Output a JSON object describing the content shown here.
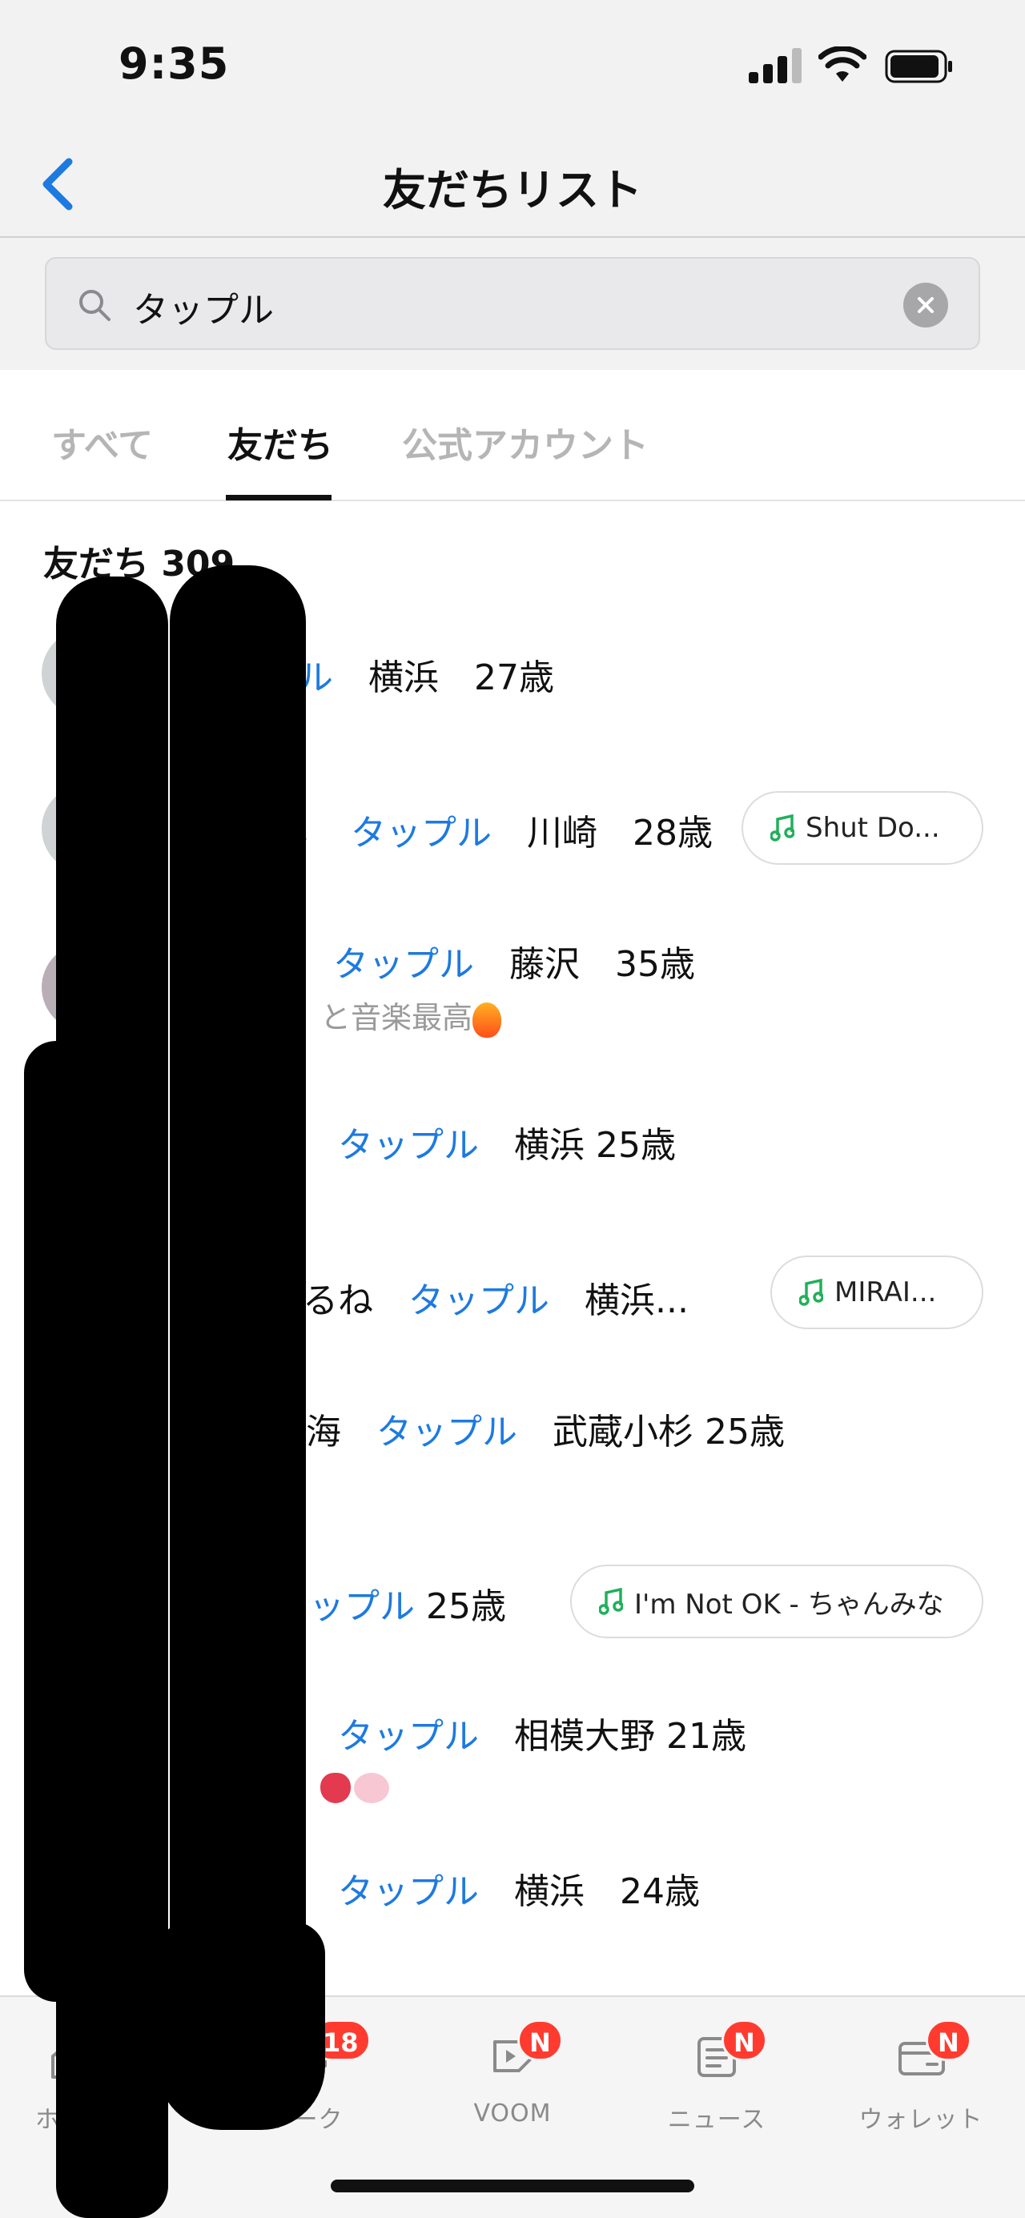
{
  "status_bar": {
    "time": "9:35"
  },
  "header": {
    "title": "友だちリスト"
  },
  "search": {
    "value": "タップル"
  },
  "tabs": [
    {
      "label": "すべて",
      "active": false
    },
    {
      "label": "友だち",
      "active": true
    },
    {
      "label": "公式アカウント",
      "active": false
    }
  ],
  "section": {
    "title": "友だち 309"
  },
  "friends": [
    {
      "prefix": "",
      "highlight": "タップル",
      "suffix": "　横浜　27歳",
      "status": "",
      "music": ""
    },
    {
      "prefix": "ヽ",
      "highlight": "タップル",
      "suffix": "　川崎　28歳",
      "status": "",
      "music": "Shut Do..."
    },
    {
      "prefix": "ﾃ",
      "highlight": "タップル",
      "suffix": "　藤沢　35歳",
      "status": "と音楽最高",
      "music": ""
    },
    {
      "prefix": "",
      "highlight": "タップル",
      "suffix": "　横浜 25歳",
      "status": "",
      "music": ""
    },
    {
      "prefix": "るね",
      "highlight": "タップル",
      "suffix": "　横浜...",
      "status": "",
      "music": "MIRAI..."
    },
    {
      "prefix": "海",
      "highlight": "タップル",
      "suffix": "　武蔵小杉 25歳",
      "status": "",
      "music": ""
    },
    {
      "prefix": "",
      "highlight": "ップル",
      "suffix": " 25歳",
      "status": "",
      "music": "I'm Not OK - ちゃんみな"
    },
    {
      "prefix": "",
      "highlight": "タップル",
      "suffix": "　相模大野 21歳",
      "status": "",
      "music": ""
    },
    {
      "prefix": "",
      "highlight": "タップル",
      "suffix": "　横浜　24歳",
      "status": "",
      "music": ""
    }
  ],
  "tab_bar": {
    "items": [
      {
        "label": "ホーム",
        "icon": "home-icon",
        "badge": ""
      },
      {
        "label": "トーク",
        "icon": "chat-bubble-icon",
        "badge": "18"
      },
      {
        "label": "VOOM",
        "icon": "voom-icon",
        "badge": "N"
      },
      {
        "label": "ニュース",
        "icon": "news-icon",
        "badge": "N"
      },
      {
        "label": "ウォレット",
        "icon": "wallet-icon",
        "badge": "N"
      }
    ]
  },
  "colors": {
    "highlight": "#1d7ae0",
    "badge": "#ff3b30",
    "music_note": "#20b05a",
    "online_dot": "#14b84a"
  }
}
